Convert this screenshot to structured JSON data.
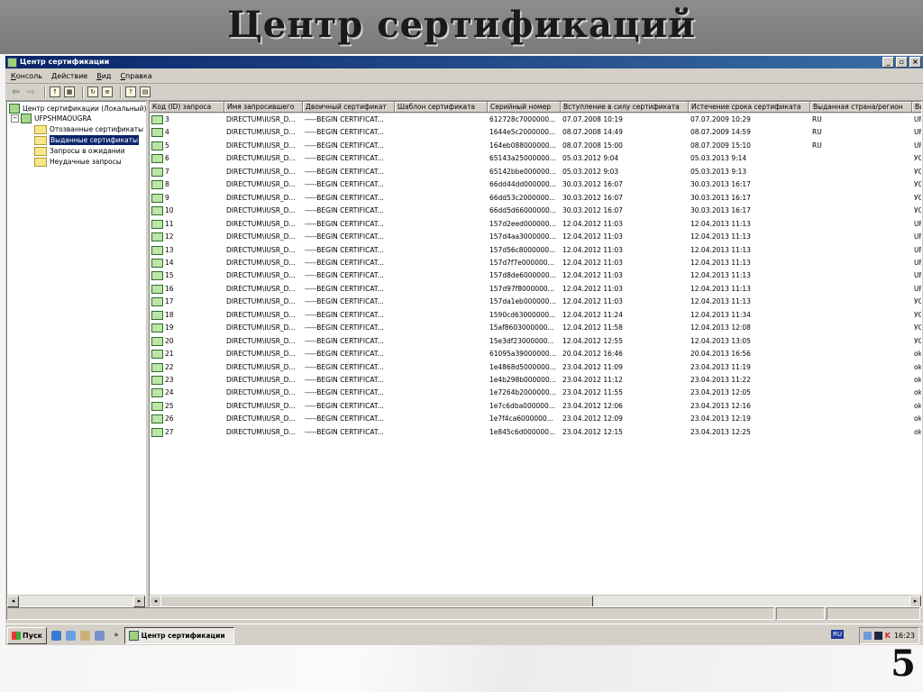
{
  "slide": {
    "title": "Центр сертификаций",
    "number": "5"
  },
  "window": {
    "title": "Центр сертификации",
    "buttons": [
      "_",
      "`",
      "×"
    ]
  },
  "menu": [
    "Консоль",
    "Действие",
    "Вид",
    "Справка"
  ],
  "tree": [
    {
      "label": "Центр сертификации (Локальный)",
      "icon": "ca-icon"
    },
    {
      "label": "UFPSHMAOUGRA",
      "icon": "cert-icon"
    },
    {
      "label": "Отозванные сертификаты",
      "icon": "folder-icon"
    },
    {
      "label": "Выданные сертификаты",
      "icon": "folder-open-icon",
      "selected": true
    },
    {
      "label": "Запросы в ожидании",
      "icon": "folder-icon"
    },
    {
      "label": "Неудачные запросы",
      "icon": "folder-icon"
    }
  ],
  "columns": [
    "Код (ID) запроса",
    "Имя запросившего",
    "Двоичный сертификат",
    "Шаблон сертификата",
    "Серийный номер",
    "Вступление в силу сертификата",
    "Истечение срока сертификата",
    "Выданная страна/регион",
    "Вь"
  ],
  "rows": [
    [
      "3",
      "DIRECTUM\\IUSR_D...",
      "-----BEGIN CERTIFICAT...",
      "",
      "612728c7000000...",
      "07.07.2008 10:19",
      "07.07.2009 10:29",
      "RU",
      "UF"
    ],
    [
      "4",
      "DIRECTUM\\IUSR_D...",
      "-----BEGIN CERTIFICAT...",
      "",
      "1644e5c2000000...",
      "08.07.2008 14:49",
      "08.07.2009 14:59",
      "RU",
      "UF"
    ],
    [
      "5",
      "DIRECTUM\\IUSR_D...",
      "-----BEGIN CERTIFICAT...",
      "",
      "164eb088000000...",
      "08.07.2008 15:00",
      "08.07.2009 15:10",
      "RU",
      "UF"
    ],
    [
      "6",
      "DIRECTUM\\IUSR_D...",
      "-----BEGIN CERTIFICAT...",
      "",
      "65143a25000000...",
      "05.03.2012 9:04",
      "05.03.2013 9:14",
      "",
      "УС"
    ],
    [
      "7",
      "DIRECTUM\\IUSR_D...",
      "-----BEGIN CERTIFICAT...",
      "",
      "65142bbe000000...",
      "05.03.2012 9:03",
      "05.03.2013 9:13",
      "",
      "УС"
    ],
    [
      "8",
      "DIRECTUM\\IUSR_D...",
      "-----BEGIN CERTIFICAT...",
      "",
      "66dd44dd000000...",
      "30.03.2012 16:07",
      "30.03.2013 16:17",
      "",
      "УС"
    ],
    [
      "9",
      "DIRECTUM\\IUSR_D...",
      "-----BEGIN CERTIFICAT...",
      "",
      "66dd53c2000000...",
      "30.03.2012 16:07",
      "30.03.2013 16:17",
      "",
      "УС"
    ],
    [
      "10",
      "DIRECTUM\\IUSR_D...",
      "-----BEGIN CERTIFICAT...",
      "",
      "66dd5d66000000...",
      "30.03.2012 16:07",
      "30.03.2013 16:17",
      "",
      "УС"
    ],
    [
      "11",
      "DIRECTUM\\IUSR_D...",
      "-----BEGIN CERTIFICAT...",
      "",
      "157d2eed000000...",
      "12.04.2012 11:03",
      "12.04.2013 11:13",
      "",
      "UF"
    ],
    [
      "12",
      "DIRECTUM\\IUSR_D...",
      "-----BEGIN CERTIFICAT...",
      "",
      "157d4aa3000000...",
      "12.04.2012 11:03",
      "12.04.2013 11:13",
      "",
      "UF"
    ],
    [
      "13",
      "DIRECTUM\\IUSR_D...",
      "-----BEGIN CERTIFICAT...",
      "",
      "157d56c8000000...",
      "12.04.2012 11:03",
      "12.04.2013 11:13",
      "",
      "UF"
    ],
    [
      "14",
      "DIRECTUM\\IUSR_D...",
      "-----BEGIN CERTIFICAT...",
      "",
      "157d7f7e000000...",
      "12.04.2012 11:03",
      "12.04.2013 11:13",
      "",
      "UF"
    ],
    [
      "15",
      "DIRECTUM\\IUSR_D...",
      "-----BEGIN CERTIFICAT...",
      "",
      "157d8de6000000...",
      "12.04.2012 11:03",
      "12.04.2013 11:13",
      "",
      "UF"
    ],
    [
      "16",
      "DIRECTUM\\IUSR_D...",
      "-----BEGIN CERTIFICAT...",
      "",
      "157d97f8000000...",
      "12.04.2012 11:03",
      "12.04.2013 11:13",
      "",
      "UF"
    ],
    [
      "17",
      "DIRECTUM\\IUSR_D...",
      "-----BEGIN CERTIFICAT...",
      "",
      "157da1eb000000...",
      "12.04.2012 11:03",
      "12.04.2013 11:13",
      "",
      "УС"
    ],
    [
      "18",
      "DIRECTUM\\IUSR_D...",
      "-----BEGIN CERTIFICAT...",
      "",
      "1590cd63000000...",
      "12.04.2012 11:24",
      "12.04.2013 11:34",
      "",
      "УС"
    ],
    [
      "19",
      "DIRECTUM\\IUSR_D...",
      "-----BEGIN CERTIFICAT...",
      "",
      "15af8603000000...",
      "12.04.2012 11:58",
      "12.04.2013 12:08",
      "",
      "УС"
    ],
    [
      "20",
      "DIRECTUM\\IUSR_D...",
      "-----BEGIN CERTIFICAT...",
      "",
      "15e3df23000000...",
      "12.04.2012 12:55",
      "12.04.2013 13:05",
      "",
      "УС"
    ],
    [
      "21",
      "DIRECTUM\\IUSR_D...",
      "-----BEGIN CERTIFICAT...",
      "",
      "61095a39000000...",
      "20.04.2012 16:46",
      "20.04.2013 16:56",
      "",
      "ok"
    ],
    [
      "22",
      "DIRECTUM\\IUSR_D...",
      "-----BEGIN CERTIFICAT...",
      "",
      "1e4868d5000000...",
      "23.04.2012 11:09",
      "23.04.2013 11:19",
      "",
      "ok"
    ],
    [
      "23",
      "DIRECTUM\\IUSR_D...",
      "-----BEGIN CERTIFICAT...",
      "",
      "1e4b298b000000...",
      "23.04.2012 11:12",
      "23.04.2013 11:22",
      "",
      "ok"
    ],
    [
      "24",
      "DIRECTUM\\IUSR_D...",
      "-----BEGIN CERTIFICAT...",
      "",
      "1e7264b2000000...",
      "23.04.2012 11:55",
      "23.04.2013 12:05",
      "",
      "ok"
    ],
    [
      "25",
      "DIRECTUM\\IUSR_D...",
      "-----BEGIN CERTIFICAT...",
      "",
      "1e7c6dba000000...",
      "23.04.2012 12:06",
      "23.04.2013 12:16",
      "",
      "ok"
    ],
    [
      "26",
      "DIRECTUM\\IUSR_D...",
      "-----BEGIN CERTIFICAT...",
      "",
      "1e7f4ca6000000...",
      "23.04.2012 12:09",
      "23.04.2013 12:19",
      "",
      "ok"
    ],
    [
      "27",
      "DIRECTUM\\IUSR_D...",
      "-----BEGIN CERTIFICAT...",
      "",
      "1e845c6d000000...",
      "23.04.2012 12:15",
      "23.04.2013 12:25",
      "",
      "ok"
    ]
  ],
  "taskbar": {
    "start": "Пуск",
    "chevron": "»",
    "task": "Центр сертификации",
    "lang": "RU",
    "clock": "16:23"
  },
  "colors": {
    "titlebar": "#0a246a",
    "chrome": "#d4d0c8",
    "selection": "#0a246a"
  }
}
